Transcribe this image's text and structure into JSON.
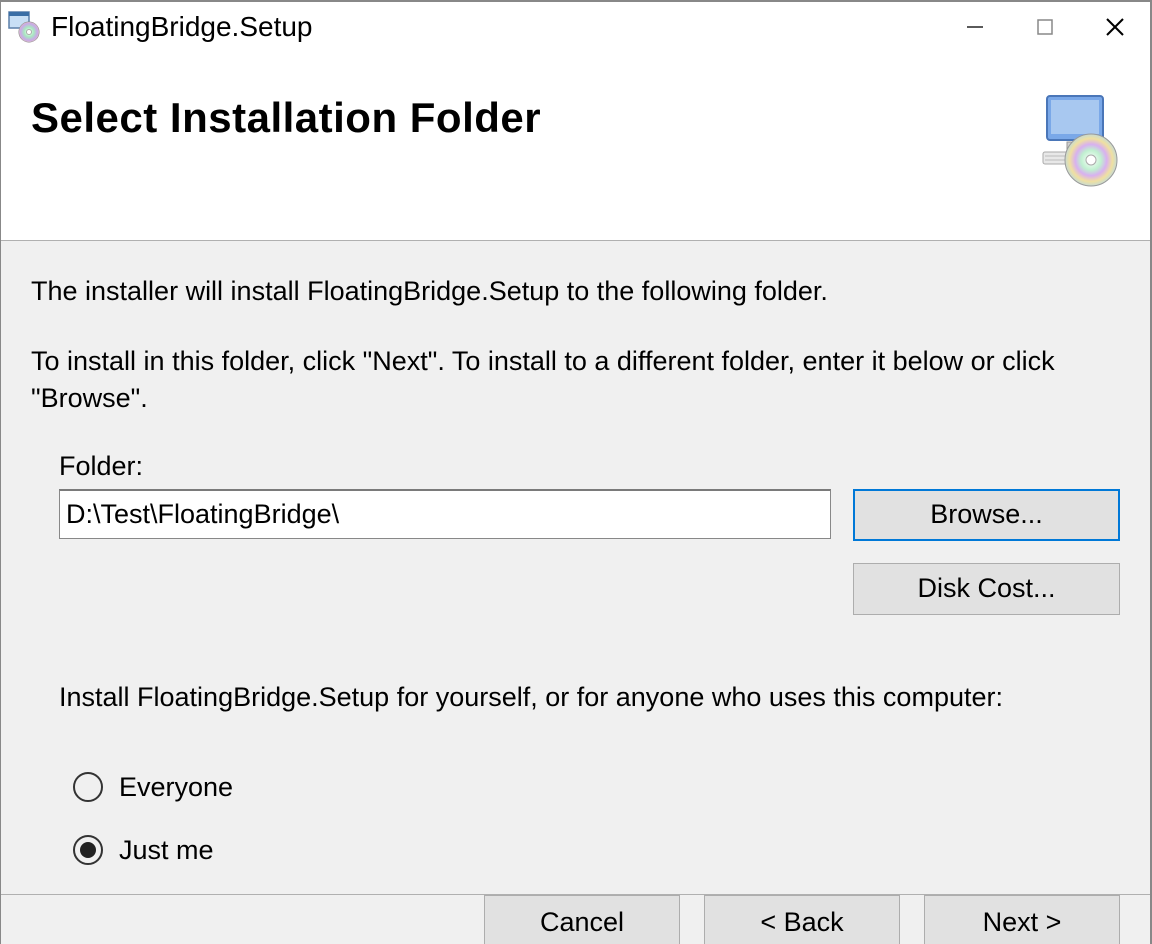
{
  "titlebar": {
    "title": "FloatingBridge.Setup"
  },
  "header": {
    "heading": "Select Installation Folder"
  },
  "body": {
    "desc1": "The installer will install FloatingBridge.Setup to the following folder.",
    "desc2": "To install in this folder, click \"Next\". To install to a different folder, enter it below or click \"Browse\".",
    "folder_label": "Folder:",
    "folder_value": "D:\\Test\\FloatingBridge\\",
    "browse_label": "Browse...",
    "disk_cost_label": "Disk Cost...",
    "install_for_prompt": "Install FloatingBridge.Setup for yourself, or for anyone who uses this computer:",
    "radio_everyone": "Everyone",
    "radio_just_me": "Just me",
    "selected_radio": "just_me"
  },
  "footer": {
    "cancel": "Cancel",
    "back": "< Back",
    "next": "Next >"
  }
}
